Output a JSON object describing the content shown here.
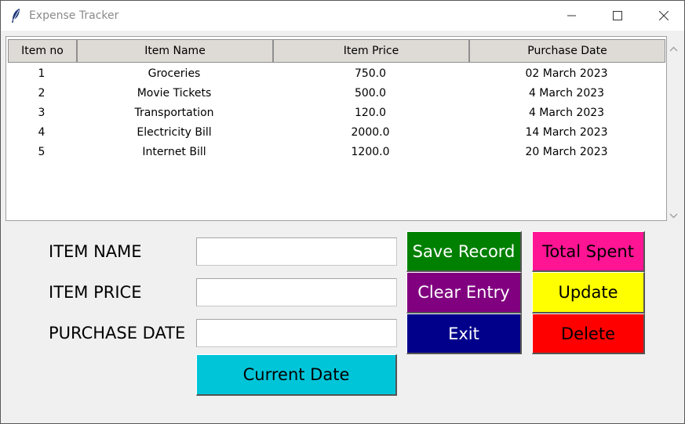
{
  "window": {
    "title": "Expense Tracker",
    "icon": "feather-icon"
  },
  "table": {
    "columns": [
      "Item no",
      "Item Name",
      "Item Price",
      "Purchase Date"
    ],
    "rows": [
      {
        "no": "1",
        "name": "Groceries",
        "price": "750.0",
        "date": "02 March 2023"
      },
      {
        "no": "2",
        "name": "Movie Tickets",
        "price": "500.0",
        "date": "4 March 2023"
      },
      {
        "no": "3",
        "name": "Transportation",
        "price": "120.0",
        "date": "4 March 2023"
      },
      {
        "no": "4",
        "name": "Electricity Bill",
        "price": "2000.0",
        "date": "14 March 2023"
      },
      {
        "no": "5",
        "name": "Internet Bill",
        "price": "1200.0",
        "date": "20 March 2023"
      }
    ]
  },
  "form": {
    "item_name_label": "ITEM NAME",
    "item_price_label": "ITEM PRICE",
    "purchase_date_label": "PURCHASE DATE",
    "item_name_value": "",
    "item_price_value": "",
    "purchase_date_value": ""
  },
  "buttons": {
    "save": "Save Record",
    "clear": "Clear Entry",
    "exit": "Exit",
    "total": "Total Spent",
    "update": "Update",
    "delete": "Delete",
    "current_date": "Current Date"
  },
  "colors": {
    "save": "#008000",
    "clear": "#800080",
    "exit": "#00008b",
    "total": "#ff1493",
    "update": "#ffff00",
    "delete": "#ff0000",
    "current_date": "#00c5d9"
  }
}
